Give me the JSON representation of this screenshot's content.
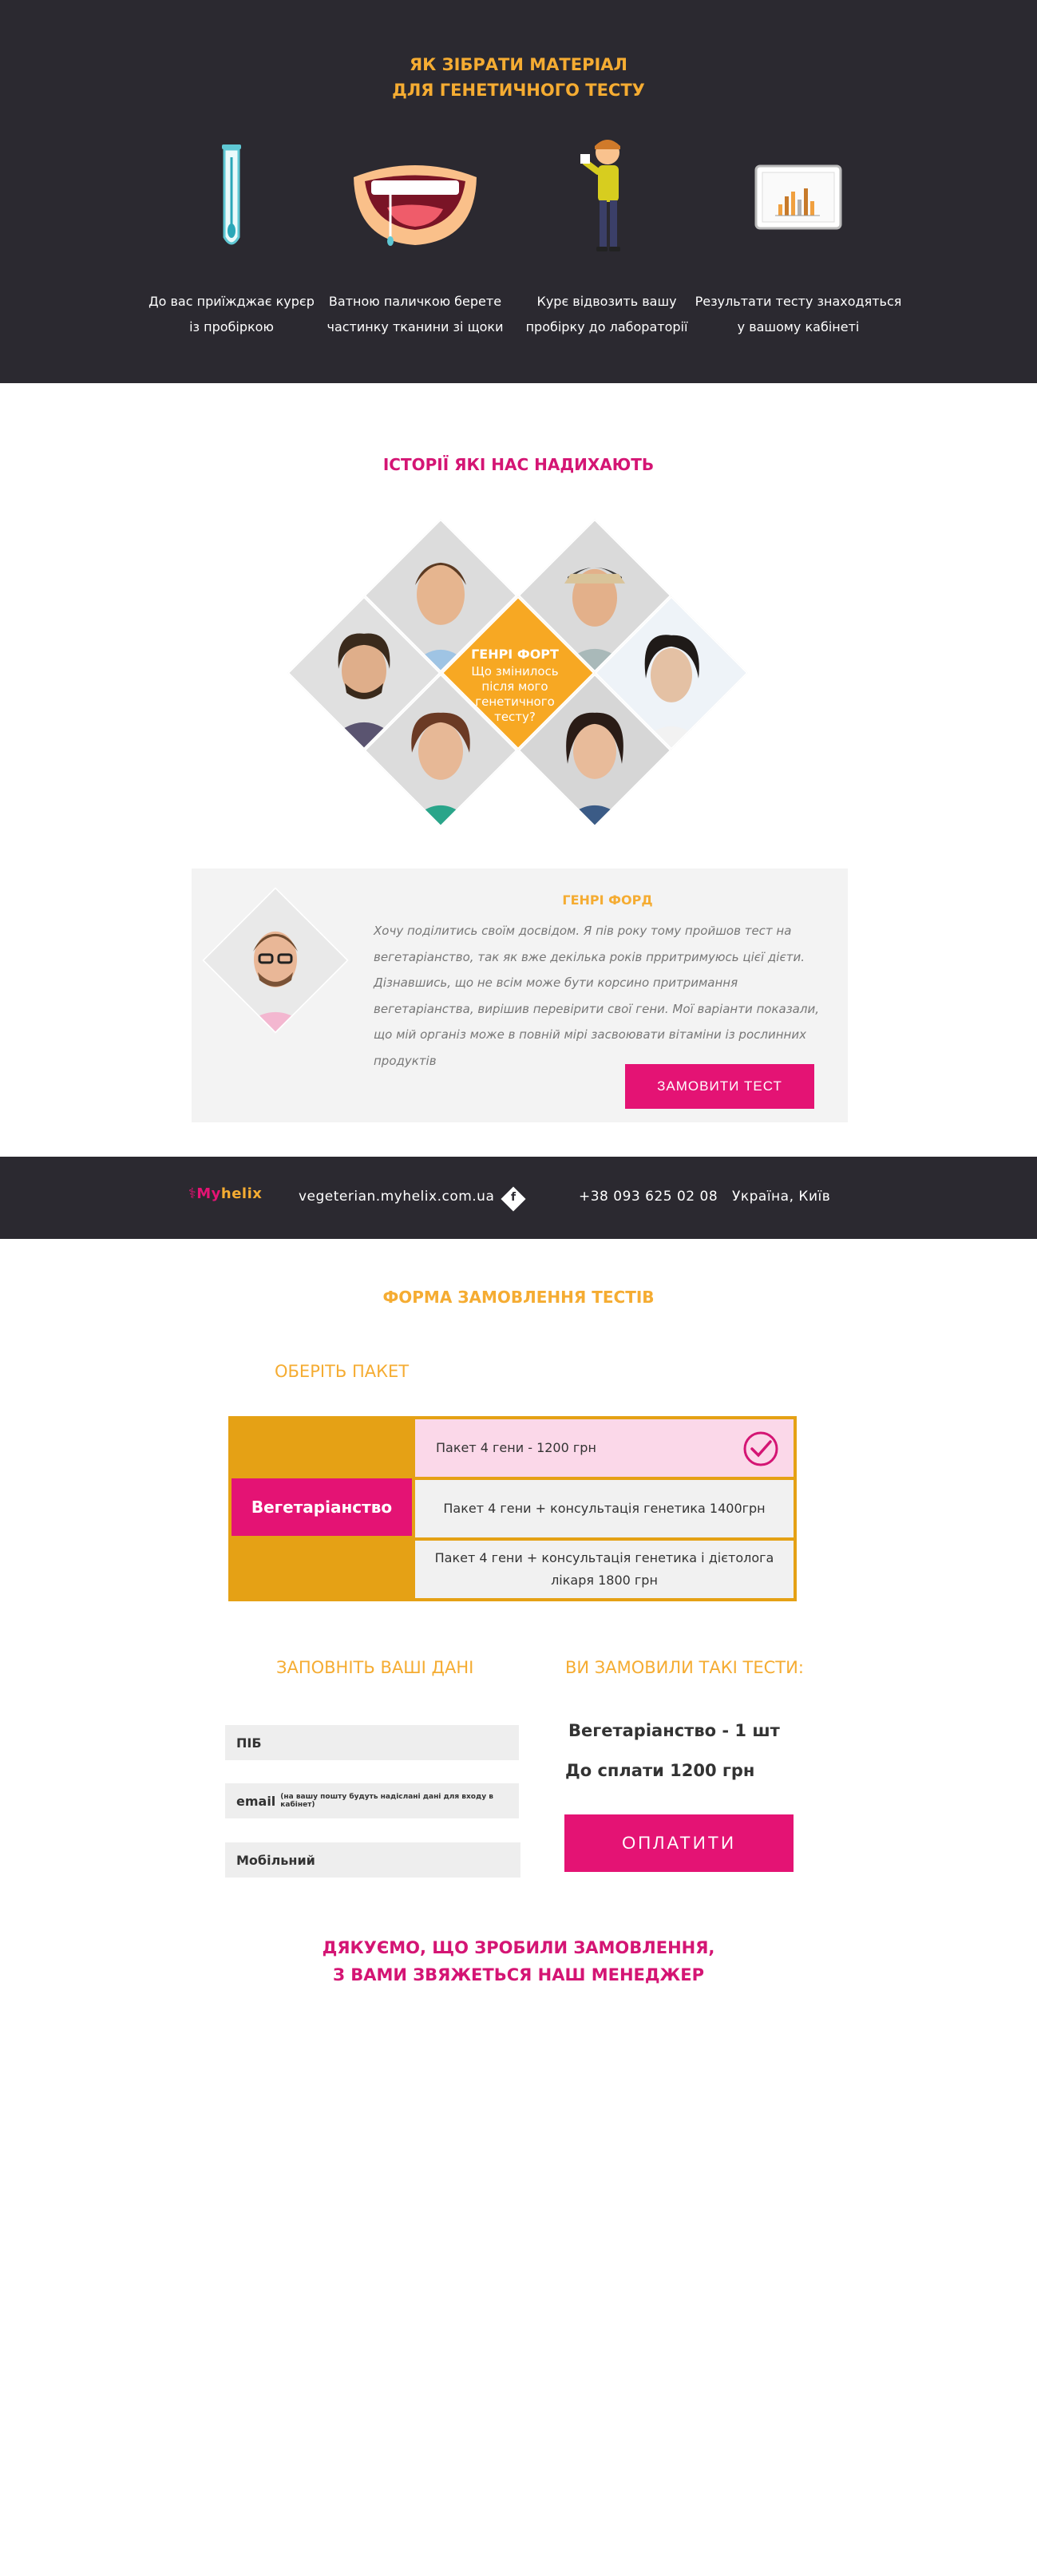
{
  "how": {
    "title_line1": "ЯК ЗІБРАТИ МАТЕРІАЛ",
    "title_line2": "ДЛЯ ГЕНЕТИЧНОГО ТЕСТУ",
    "steps": [
      {
        "line1": "До вас приїжджає курєр",
        "line2": "із пробіркою",
        "icon": "test-tube-icon"
      },
      {
        "line1": "Ватною паличкою берете",
        "line2": "частинку тканини зі щоки",
        "icon": "mouth-swab-icon"
      },
      {
        "line1": "Курє відвозить вашу",
        "line2": "пробірку до лабораторії",
        "icon": "courier-icon"
      },
      {
        "line1": "Результати тесту знаходяться",
        "line2": "у вашому кабінеті",
        "icon": "results-chart-icon"
      }
    ]
  },
  "stories": {
    "title": "ІСТОРІЇ ЯКІ НАС НАДИХАЮТЬ",
    "center_name": "ГЕНРІ ФОРТ",
    "center_question": "Що змінилось після мого генетичного тесту?"
  },
  "testimonial": {
    "name": "ГЕНРІ ФОРД",
    "text": "Хочу поділитись своїм досвідом. Я пів року тому пройшов тест на вегетаріанство, так як вже декілька років прритримуюсь цієї дієти. Дізнавшись, що не всім може бути корсино притримання вегетаріанства, вирішив перевірити свої гени. Мої варіанти показали, що мій організ може в повній мірі засвоювати вітаміни із рослинних продуктів",
    "button": "ЗАМОВИТИ  ТЕСТ"
  },
  "bar": {
    "logo_prefix": "My",
    "logo_suffix": "helix",
    "site": "vegeterian.myhelix.com.ua",
    "social": "f",
    "phone": "+38 093 625 02 08",
    "location": "Україна, Київ"
  },
  "order": {
    "title": "ФОРМА ЗАМОВЛЕННЯ ТЕСТІВ",
    "choose_package": "ОБЕРІТЬ ПАКЕТ",
    "category": "Вегетаріанство",
    "packages": [
      {
        "label": "Пакет 4 гени - 1200 грн",
        "selected": true
      },
      {
        "label": "Пакет 4 гени + консультація генетика 1400грн",
        "selected": false
      },
      {
        "label": "Пакет 4 гени + консультація генетика і дієтолога лікаря 1800 грн",
        "selected": false
      }
    ],
    "fill_data_title": "ЗАПОВНІТЬ ВАШІ ДАНІ",
    "fields": {
      "name": "ПІБ",
      "email": "email",
      "email_hint": "(на вашу пошту будуть надіслані дані для входу в кабінет)",
      "phone": "Мобільний"
    },
    "ordered_title": "ВИ ЗАМОВИЛИ ТАКІ ТЕСТИ:",
    "ordered_item": "Вегетаріанство - 1 шт",
    "to_pay": "До сплати 1200 грн",
    "pay_button": "ОПЛАТИТИ"
  },
  "thanks": {
    "line1": "ДЯКУЄМО, ЩО ЗРОБИЛИ ЗАМОВЛЕННЯ,",
    "line2": "З ВАМИ ЗВЯЖЕТЬСЯ НАШ МЕНЕДЖЕР"
  },
  "colors": {
    "dark": "#2b2930",
    "orange": "#f5ac32",
    "pink": "#e41374",
    "light_pink": "#fbd8e9",
    "gray_bg": "#f3f3f3"
  }
}
